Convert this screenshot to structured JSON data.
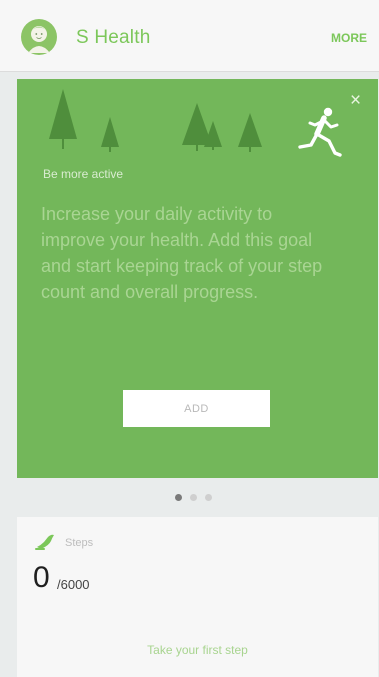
{
  "header": {
    "title": "S Health",
    "more_label": "MORE"
  },
  "promo_card": {
    "subtitle": "Be more active",
    "body": "Increase your daily activity to improve your health. Add this goal and start keeping track of your step count and overall progress.",
    "add_label": "ADD",
    "close_icon": "×",
    "colors": {
      "background": "#73b75a",
      "tree": "#4f8e3c"
    }
  },
  "pager": {
    "total": 3,
    "active": 1
  },
  "steps_card": {
    "label": "Steps",
    "count": "0",
    "goal": "/6000",
    "cta": "Take your first step",
    "accent": "#7cc75a"
  }
}
